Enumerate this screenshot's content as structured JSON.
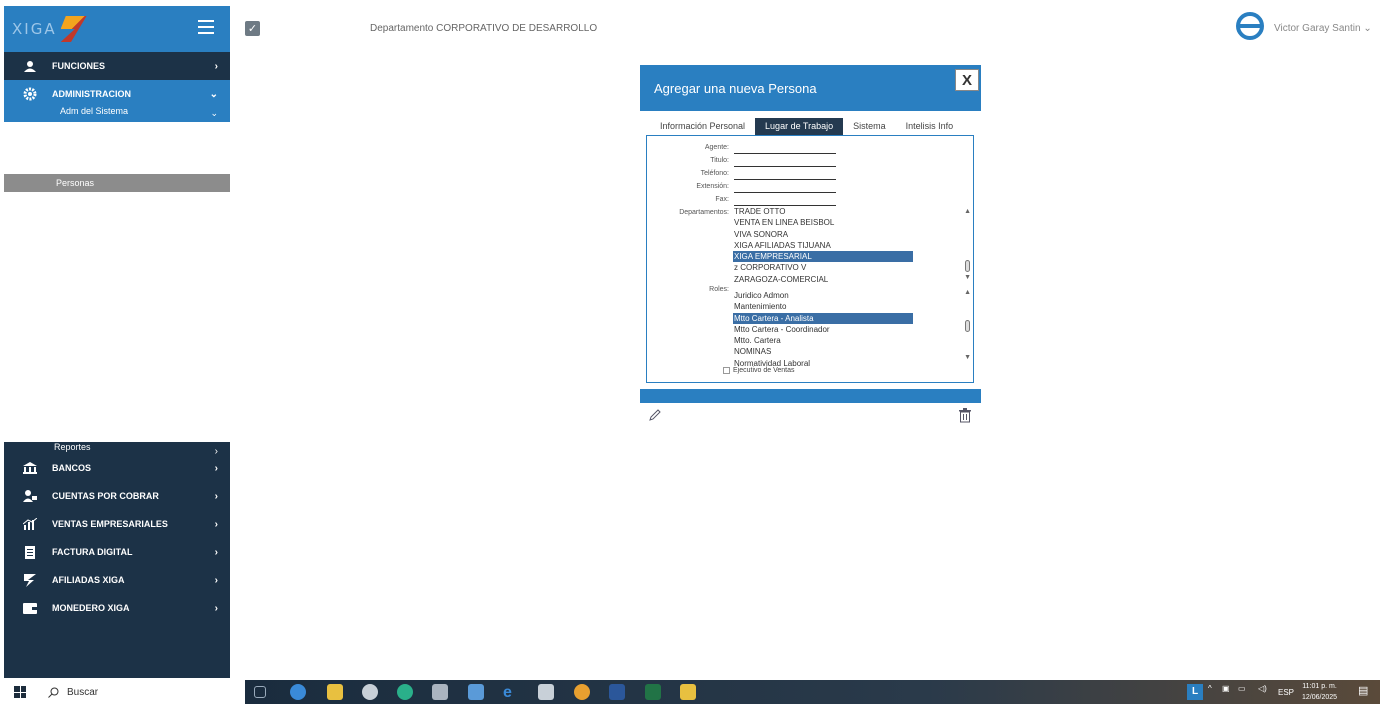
{
  "sidebar": {
    "logo_text": "XIGA",
    "funciones": "FUNCIONES",
    "administracion": "ADMINISTRACION",
    "adm_sistema": "Adm del Sistema",
    "personas": "Personas",
    "reportes": "Reportes",
    "bottom_items": [
      {
        "label": "BANCOS",
        "icon": "bank-icon"
      },
      {
        "label": "CUENTAS POR COBRAR",
        "icon": "users-money-icon"
      },
      {
        "label": "VENTAS EMPRESARIALES",
        "icon": "chart-icon"
      },
      {
        "label": "FACTURA DIGITAL",
        "icon": "document-icon"
      },
      {
        "label": "AFILIADAS XIGA",
        "icon": "xiga-icon"
      },
      {
        "label": "MONEDERO XIGA",
        "icon": "wallet-icon"
      }
    ]
  },
  "header": {
    "department": "Departamento CORPORATIVO DE DESARROLLO",
    "user": "Victor Garay Santin"
  },
  "modal": {
    "title": "Agregar una nueva Persona",
    "close_label": "X",
    "tabs": [
      "Información Personal",
      "Lugar de Trabajo",
      "Sistema",
      "Intelisis Info"
    ],
    "active_tab": 1,
    "fields": {
      "agente": "Agente:",
      "titulo": "Titulo:",
      "telefono": "Teléfono:",
      "extension": "Extensión:",
      "fax": "Fax:",
      "departamentos": "Departamentos:",
      "roles": "Roles:"
    },
    "departamentos": [
      "TRADE OTTO",
      "VENTA EN LINEA BEISBOL",
      "VIVA SONORA",
      "XIGA AFILIADAS TIJUANA",
      "XIGA EMPRESARIAL",
      "z CORPORATIVO V",
      "ZARAGOZA-COMERCIAL"
    ],
    "departamento_selected": 4,
    "roles": [
      "Juridico Admon",
      "Mantenimiento",
      "Mtto Cartera - Analista",
      "Mtto Cartera - Coordinador",
      "Mtto. Cartera",
      "NOMINAS",
      "Normatividad Laboral"
    ],
    "rol_selected": 2,
    "checkbox_label": "Ejecutivo de Ventas"
  },
  "taskbar": {
    "search": "Buscar",
    "lang_badge": "L",
    "lang": "ESP",
    "time": "11:01 p. m.",
    "date": "12/06/2025"
  },
  "colors": {
    "accent": "#2a7fc1",
    "sidebar_dark": "#1c3247",
    "tab_active": "#243a50",
    "selection": "#3a6ea5"
  }
}
